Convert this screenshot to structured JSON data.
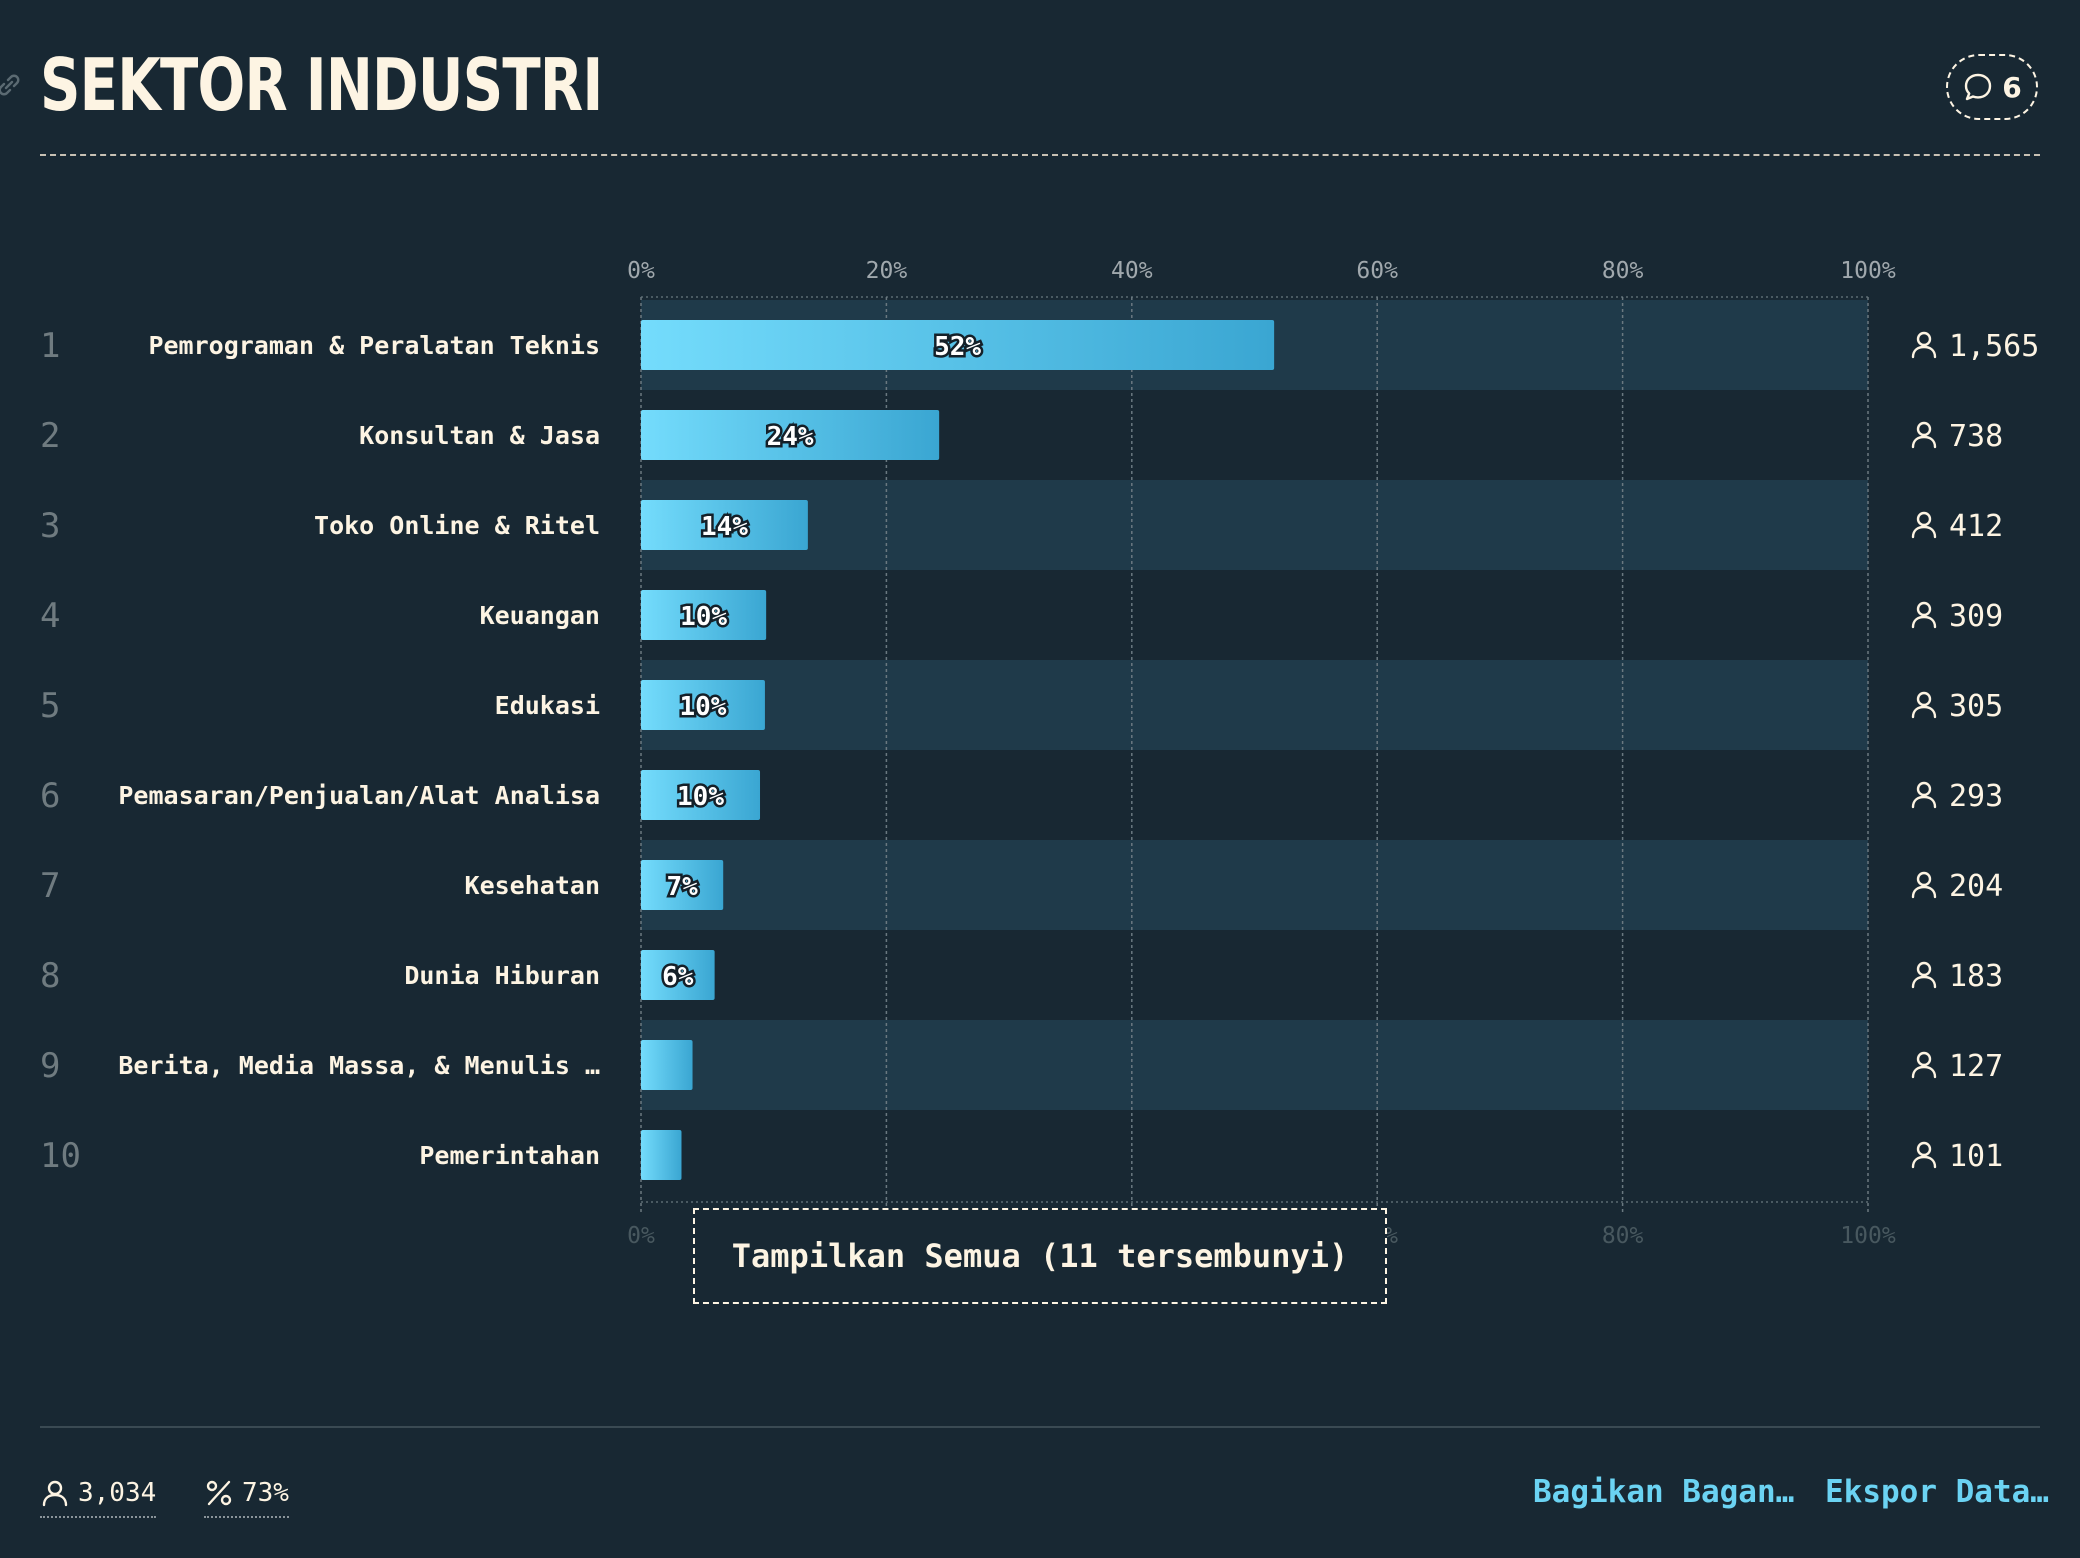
{
  "header": {
    "title": "SEKTOR INDUSTRI",
    "comment_count": "6"
  },
  "colors": {
    "background": "#182833",
    "row_alt": "#1f3a4a",
    "bar_gradient_start": "#74dcfc",
    "bar_gradient_end": "#3aa6d2",
    "text": "#fdf4e3",
    "link": "#6bd3f3"
  },
  "chart_data": {
    "type": "bar",
    "orientation": "horizontal",
    "x_ticks": [
      "0%",
      "20%",
      "40%",
      "60%",
      "80%",
      "100%"
    ],
    "xlim": [
      0,
      100
    ],
    "grid": true,
    "rows": [
      {
        "rank": "1",
        "category": "Pemrograman & Peralatan Teknis",
        "percent": 51.6,
        "label": "52%",
        "count": "1,565"
      },
      {
        "rank": "2",
        "category": "Konsultan & Jasa",
        "percent": 24.3,
        "label": "24%",
        "count": "738"
      },
      {
        "rank": "3",
        "category": "Toko Online & Ritel",
        "percent": 13.6,
        "label": "14%",
        "count": "412"
      },
      {
        "rank": "4",
        "category": "Keuangan",
        "percent": 10.2,
        "label": "10%",
        "count": "309"
      },
      {
        "rank": "5",
        "category": "Edukasi",
        "percent": 10.1,
        "label": "10%",
        "count": "305"
      },
      {
        "rank": "6",
        "category": "Pemasaran/Penjualan/Alat Analisa",
        "percent": 9.7,
        "label": "10%",
        "count": "293"
      },
      {
        "rank": "7",
        "category": "Kesehatan",
        "percent": 6.7,
        "label": "7%",
        "count": "204"
      },
      {
        "rank": "8",
        "category": "Dunia Hiburan",
        "percent": 6.0,
        "label": "6%",
        "count": "183"
      },
      {
        "rank": "9",
        "category": "Berita, Media Massa, & Menulis …",
        "percent": 4.2,
        "label": "",
        "count": "127"
      },
      {
        "rank": "10",
        "category": "Pemerintahan",
        "percent": 3.3,
        "label": "",
        "count": "101"
      }
    ]
  },
  "show_all_label": "Tampilkan Semua (11 tersembunyi)",
  "footer": {
    "respondents": "3,034",
    "percent": "73%",
    "share_label": "Bagikan Bagan…",
    "export_label": "Ekspor Data…"
  }
}
